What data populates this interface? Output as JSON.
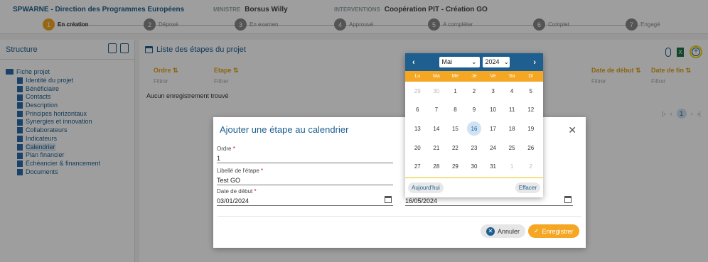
{
  "header": {
    "program": "SPWARNE - Direction des Programmes Européens",
    "minister_label": "MINISTRE",
    "minister": "Borsus Willy",
    "intervention_label": "INTERVENTIONS",
    "intervention": "Coopération PIT - Création GO"
  },
  "steps": [
    {
      "num": "1",
      "label": "En création"
    },
    {
      "num": "2",
      "label": "Déposé"
    },
    {
      "num": "3",
      "label": "En examen"
    },
    {
      "num": "4",
      "label": "Approuvé"
    },
    {
      "num": "5",
      "label": "A compléter"
    },
    {
      "num": "6",
      "label": "Complet"
    },
    {
      "num": "7",
      "label": "Engagé"
    }
  ],
  "sidebar": {
    "title": "Structure",
    "root": "Fiche projet",
    "items": [
      "Identité du projet",
      "Bénéficiaire",
      "Contacts",
      "Description",
      "Principes horizontaux",
      "Synergies et innovation",
      "Collaborateurs",
      "Indicateurs",
      "Calendrier",
      "Plan financier",
      "Échéancier & financement",
      "Documents"
    ]
  },
  "main": {
    "title": "Liste des étapes du projet",
    "col_ordre": "Ordre ⇅",
    "col_etape": "Etape ⇅",
    "col_debut": "Date de début ⇅",
    "col_fin": "Date de fin ⇅",
    "filter": "Filtrer",
    "empty": "Aucun enregistrement trouvé",
    "page": "1",
    "xls": "X"
  },
  "dialog": {
    "title": "Ajouter une étape au calendrier",
    "ordre_label": "Ordre",
    "ordre_value": "1",
    "libelle_label": "Libellé de l'étape",
    "libelle_value": "Test GO",
    "debut_label": "Date de début",
    "debut_value": "03/01/2024",
    "fin_value": "16/05/2024",
    "cancel": "Annuler",
    "save": "Enregistrer",
    "close": "✕",
    "required": "*"
  },
  "datepicker": {
    "month": "Mai",
    "year": "2024",
    "prev": "‹",
    "next": "›",
    "dow": [
      "Lu",
      "Ma",
      "Me",
      "Je",
      "Ve",
      "Sa",
      "Di"
    ],
    "days": [
      "29",
      "30",
      "1",
      "2",
      "3",
      "4",
      "5",
      "6",
      "7",
      "8",
      "9",
      "10",
      "11",
      "12",
      "13",
      "14",
      "15",
      "16",
      "17",
      "18",
      "19",
      "20",
      "21",
      "22",
      "23",
      "24",
      "25",
      "26",
      "27",
      "28",
      "29",
      "30",
      "31",
      "1",
      "2"
    ],
    "other_month_indices": [
      0,
      1,
      33,
      34
    ],
    "selected_index": 17,
    "today": "Aujourd'hui",
    "clear": "Effacer"
  },
  "colors": {
    "primary": "#1e5f8f",
    "accent": "#f5a623"
  }
}
